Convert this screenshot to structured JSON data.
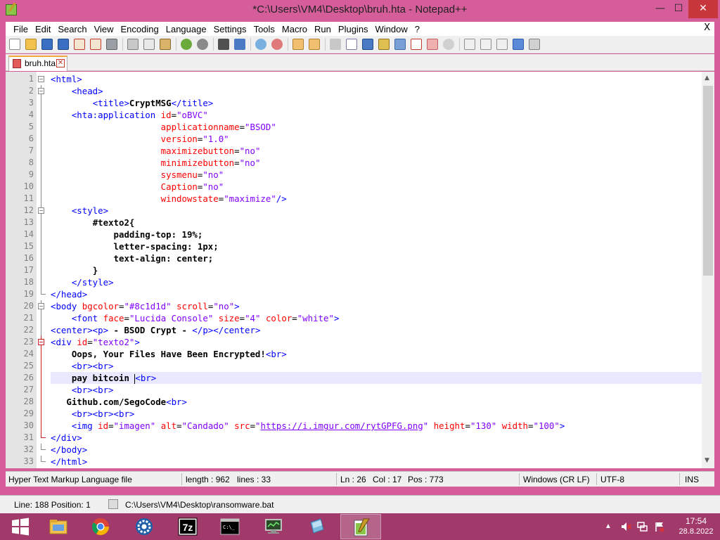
{
  "window": {
    "title": "*C:\\Users\\VM4\\Desktop\\bruh.hta - Notepad++",
    "min_glyph": "—",
    "max_glyph": "☐",
    "close_glyph": "✕"
  },
  "menubar": {
    "items": [
      "File",
      "Edit",
      "Search",
      "View",
      "Encoding",
      "Language",
      "Settings",
      "Tools",
      "Macro",
      "Run",
      "Plugins",
      "Window",
      "?"
    ],
    "close_label": "X"
  },
  "tab": {
    "label": "bruh.hta",
    "close_glyph": "✕"
  },
  "editor": {
    "current_line": 26,
    "line_numbers": [
      "1",
      "2",
      "3",
      "4",
      "5",
      "6",
      "7",
      "8",
      "9",
      "10",
      "11",
      "12",
      "13",
      "14",
      "15",
      "16",
      "17",
      "18",
      "19",
      "20",
      "21",
      "22",
      "23",
      "24",
      "25",
      "26",
      "27",
      "28",
      "29",
      "30",
      "31",
      "32",
      "33"
    ]
  },
  "status": {
    "file_type": "Hyper Text Markup Language file",
    "length": "length : 962",
    "lines": "lines : 33",
    "ln": "Ln : 26",
    "col": "Col : 17",
    "pos": "Pos : 773",
    "eol": "Windows (CR LF)",
    "encoding": "UTF-8",
    "mode": "INS"
  },
  "background_app_status": {
    "line_position": "Line: 188  Position: 1",
    "path": "C:\\Users\\VM4\\Desktop\\ransomware.bat"
  },
  "taskbar": {
    "icons": [
      "start-icon",
      "file-explorer-icon",
      "chrome-icon",
      "settings-gear-icon",
      "7zip-icon",
      "cmd-icon",
      "monitor-icon",
      "notepad-icon",
      "notepadpp-icon"
    ],
    "seven_zip_label": "7z",
    "cmd_label": "C:\\_",
    "tray_chevron": "▲",
    "clock_time": "17:54",
    "clock_date": "28.8.2022"
  },
  "colors": {
    "accent": "#d45d9a",
    "taskbar": "#a13a6a",
    "tag": "#0000ff",
    "attribute": "#ff0000",
    "value": "#8000ff"
  }
}
